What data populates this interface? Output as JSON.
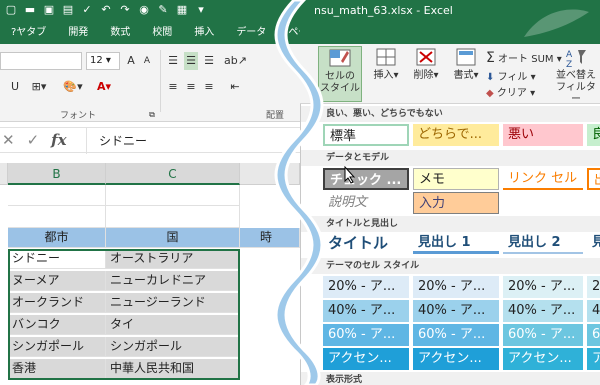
{
  "window": {
    "filename": "nsu_math_63.xlsx - Excel"
  },
  "ribbon_tabs": [
    "?ヤタブ",
    "開発",
    "数式",
    "校閲",
    "挿入",
    "データ",
    "ペー"
  ],
  "font_group": {
    "font_size": "12",
    "label": "フォント",
    "partial_label": "配置"
  },
  "formula_bar": {
    "value": "シドニー"
  },
  "columns": {
    "b": "B",
    "c": "C"
  },
  "table": {
    "headers": [
      "都市",
      "国",
      "時"
    ],
    "rows": [
      [
        "シドニー",
        "オーストラリア"
      ],
      [
        "ヌーメア",
        "ニューカレドニア"
      ],
      [
        "オークランド",
        "ニュージーランド"
      ],
      [
        "バンコク",
        "タイ"
      ],
      [
        "シンガポール",
        "シンガポール"
      ],
      [
        "香港",
        "中華人民共和国"
      ]
    ]
  },
  "right_ribbon": {
    "cell_styles": "セルの\nスタイル",
    "insert": "挿入",
    "delete": "削除",
    "format": "書式",
    "autosum": "オート SUM",
    "fill": "フィル",
    "clear": "クリア",
    "sort_filter": "並べ替え\nフィルター"
  },
  "gallery": {
    "sec_good_bad": "良い、悪い、どちらでもない",
    "sec_data_model": "データとモデル",
    "sec_titles": "タイトルと見出し",
    "sec_theme": "テーマのセル スタイル",
    "sec_number": "表示形式",
    "good_bad": [
      "標準",
      "どちらで...",
      "悪い",
      "良"
    ],
    "data_model_row1": [
      "チェック ...",
      "メモ",
      "リンク セル",
      "出"
    ],
    "data_model_row2": [
      "説明文",
      "入力"
    ],
    "titles": [
      "タイトル",
      "見出し 1",
      "見出し 2",
      "見"
    ],
    "theme_20": [
      "20% - ア...",
      "20% - ア...",
      "20% - ア...",
      "2"
    ],
    "theme_40": [
      "40% - ア...",
      "40% - ア...",
      "40% - ア...",
      "4"
    ],
    "theme_60": [
      "60% - ア...",
      "60% - ア...",
      "60% - ア...",
      "6"
    ],
    "theme_accent": [
      "アクセン...",
      "アクセン...",
      "アクセン...",
      "ア"
    ]
  }
}
